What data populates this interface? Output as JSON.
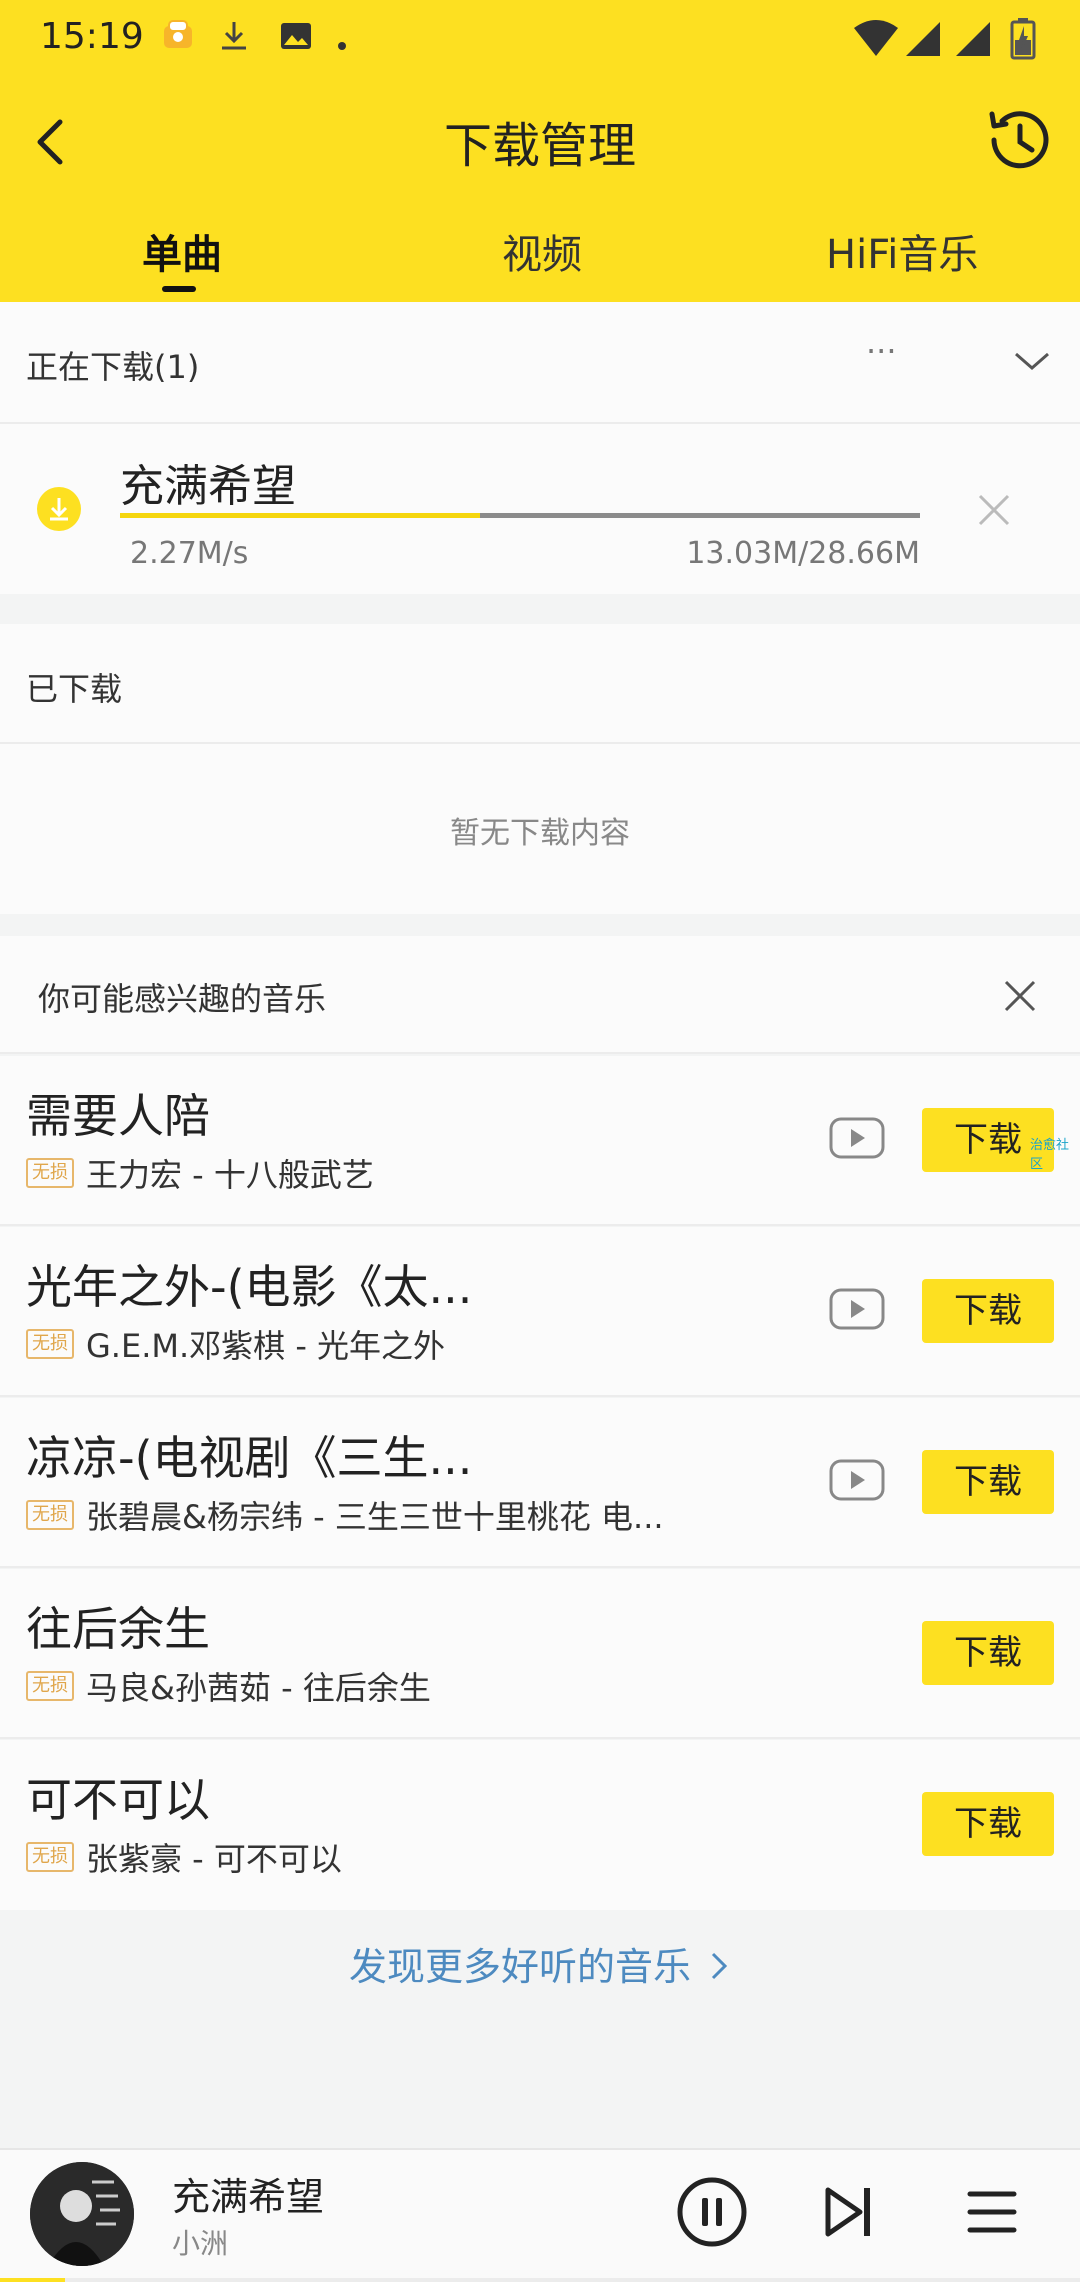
{
  "status_bar": {
    "time": "15:19"
  },
  "header": {
    "title": "下载管理"
  },
  "tabs": [
    {
      "label": "单曲",
      "active": true
    },
    {
      "label": "视频",
      "active": false
    },
    {
      "label": "HiFi音乐",
      "active": false
    }
  ],
  "downloading": {
    "title": "正在下载(1)",
    "more": "···",
    "item": {
      "title": "充满希望",
      "speed": "2.27M/s",
      "size": "13.03M/28.66M",
      "progress_fraction": 0.45
    }
  },
  "downloaded": {
    "title": "已下载",
    "empty_text": "暂无下载内容"
  },
  "recommend": {
    "title": "你可能感兴趣的音乐",
    "lossless_badge": "无损",
    "download_label": "下载",
    "promo_tag": "治愈社区",
    "songs": [
      {
        "title": "需要人陪",
        "subtitle": "王力宏 - 十八般武艺",
        "has_mv": true
      },
      {
        "title": "光年之外-(电影《太...",
        "subtitle": "G.E.M.邓紫棋 - 光年之外",
        "has_mv": true
      },
      {
        "title": "凉凉-(电视剧《三生...",
        "subtitle": "张碧晨&杨宗纬 - 三生三世十里桃花 电...",
        "has_mv": true
      },
      {
        "title": "往后余生",
        "subtitle": "马良&孙茜茹 - 往后余生",
        "has_mv": false
      },
      {
        "title": "可不可以",
        "subtitle": "张紫豪 - 可不可以",
        "has_mv": false
      }
    ],
    "discover_more": "发现更多好听的音乐"
  },
  "player": {
    "title": "充满希望",
    "artist": "小洲",
    "progress_fraction": 0.06
  },
  "colors": {
    "accent": "#fde021",
    "link": "#4d8ac0",
    "lossless": "#e0a64b"
  }
}
